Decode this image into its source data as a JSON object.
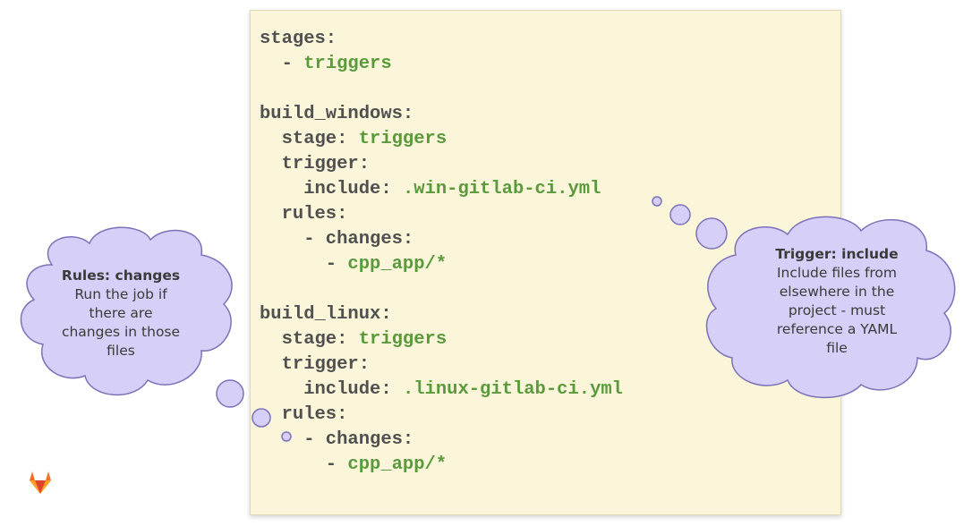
{
  "code": {
    "lines": [
      {
        "key": "stages:",
        "value": ""
      },
      {
        "key": "  - ",
        "value": "triggers"
      },
      {
        "key": "",
        "value": ""
      },
      {
        "key": "build_windows:",
        "value": ""
      },
      {
        "key": "  stage: ",
        "value": "triggers"
      },
      {
        "key": "  trigger:",
        "value": ""
      },
      {
        "key": "    include: ",
        "value": ".win-gitlab-ci.yml"
      },
      {
        "key": "  rules:",
        "value": ""
      },
      {
        "key": "    - changes:",
        "value": ""
      },
      {
        "key": "      - ",
        "value": "cpp_app/*"
      },
      {
        "key": "",
        "value": ""
      },
      {
        "key": "build_linux:",
        "value": ""
      },
      {
        "key": "  stage: ",
        "value": "triggers"
      },
      {
        "key": "  trigger:",
        "value": ""
      },
      {
        "key": "    include: ",
        "value": ".linux-gitlab-ci.yml"
      },
      {
        "key": "  rules:",
        "value": ""
      },
      {
        "key": "    - changes:",
        "value": ""
      },
      {
        "key": "      - ",
        "value": "cpp_app/*"
      }
    ]
  },
  "callouts": {
    "rules": {
      "title": "Rules: changes",
      "lines": [
        "Run the job if",
        "there are",
        "changes in those",
        "files"
      ]
    },
    "trigger": {
      "title": "Trigger: include",
      "lines": [
        "Include files from",
        "elsewhere in the",
        "project - must",
        "reference a YAML",
        "file"
      ]
    }
  },
  "colors": {
    "panel_bg": "#fbf5d9",
    "key_text": "#505050",
    "value_text": "#5a9a3c",
    "bubble_fill": "#d6cff7",
    "bubble_stroke": "#7c72b8"
  },
  "logo": {
    "icon": "gitlab-logo-icon"
  }
}
